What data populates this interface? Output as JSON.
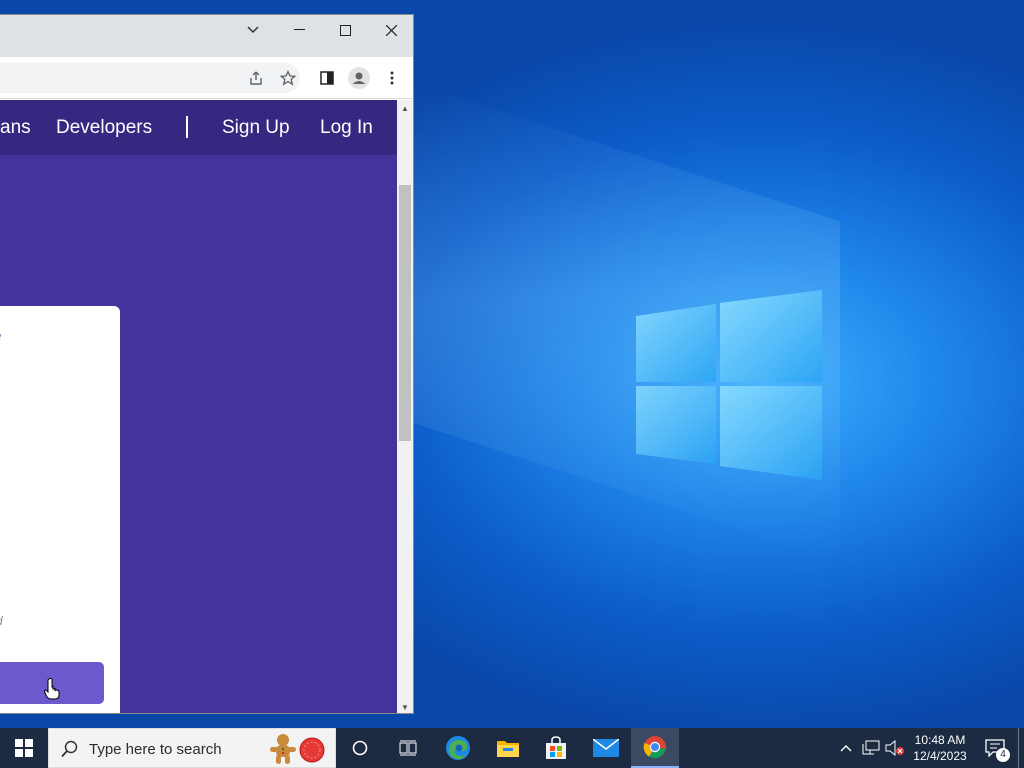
{
  "browser": {
    "nav": {
      "plans_fragment": "ans",
      "developers": "Developers",
      "separator": "|",
      "sign_up": "Sign Up",
      "log_in": "Log In"
    },
    "card": {
      "text_fragment": "e",
      "small_fragment": "load"
    }
  },
  "taskbar": {
    "search_placeholder": "Type here to search",
    "clock_time": "10:48 AM",
    "clock_date": "12/4/2023",
    "notification_count": "4"
  },
  "colors": {
    "site_purple": "#45329a",
    "site_nav": "#372780",
    "card_button": "#6a5acd",
    "taskbar": "#1c2b42"
  },
  "icons": [
    "chevron-down-icon",
    "minimize-icon",
    "maximize-icon",
    "close-icon",
    "share-icon",
    "star-icon",
    "side-panel-icon",
    "profile-icon",
    "more-icon",
    "windows-start-icon",
    "search-icon",
    "cortana-icon",
    "task-view-icon",
    "edge-icon",
    "file-explorer-icon",
    "store-icon",
    "mail-icon",
    "chrome-icon",
    "chevron-up-icon",
    "network-icon",
    "volume-muted-icon",
    "notification-icon"
  ]
}
